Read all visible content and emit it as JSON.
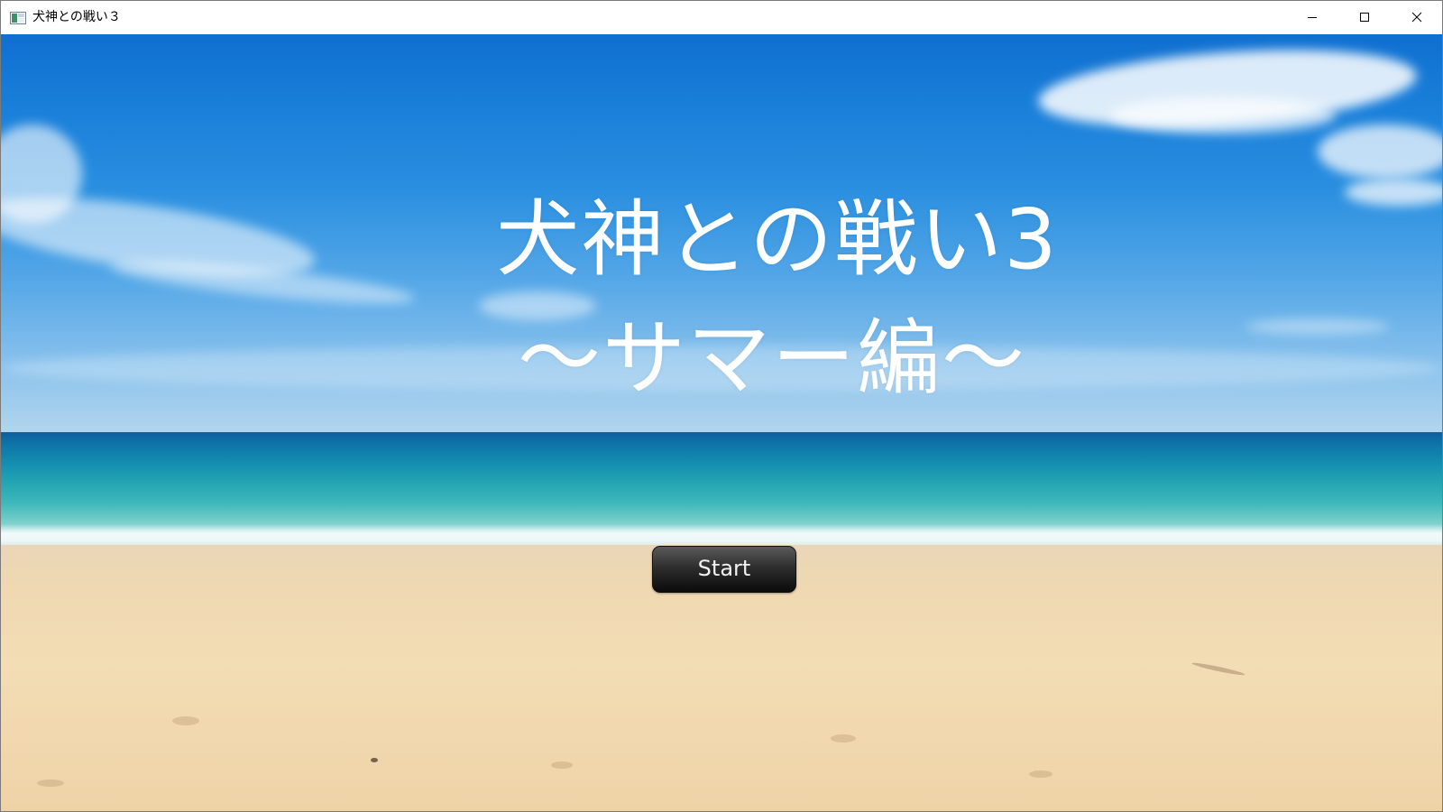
{
  "window": {
    "title": "犬神との戦い３",
    "icon": "app-window-icon",
    "controls": {
      "minimize_icon": "minimize-icon",
      "maximize_icon": "maximize-icon",
      "close_icon": "close-icon"
    }
  },
  "scene": {
    "background": "beach-sea-sky",
    "title_line1": "犬神との戦い3",
    "title_line2": "～サマー編～",
    "start_label": "Start",
    "colors": {
      "title_text": "#ffffff",
      "button_bg": "#1a1a1a",
      "button_text": "#f2f2f2"
    }
  }
}
